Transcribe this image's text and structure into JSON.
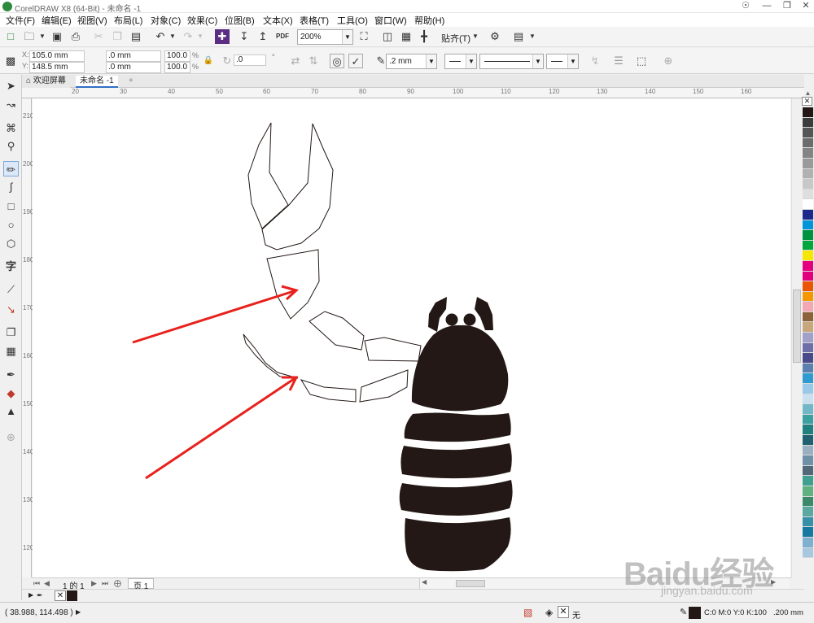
{
  "window": {
    "title": "CorelDRAW X8 (64-Bit) - 未命名 -1"
  },
  "menu": [
    "文件(F)",
    "编辑(E)",
    "视图(V)",
    "布局(L)",
    "对象(C)",
    "效果(C)",
    "位图(B)",
    "文本(X)",
    "表格(T)",
    "工具(O)",
    "窗口(W)",
    "帮助(H)"
  ],
  "toolbar": {
    "zoom": "200%",
    "snap_label": "贴齐(T)",
    "pdf_label": "PDF"
  },
  "property_bar": {
    "x": "105.0 mm",
    "y": "148.5 mm",
    "width": ".0 mm",
    "height": ".0 mm",
    "scale_x": "100.0",
    "scale_y": "100.0",
    "percent": "%",
    "rotation": ".0",
    "outline_width": ".2 mm"
  },
  "tabs": {
    "welcome": "欢迎屏幕",
    "document": "未命名 -1"
  },
  "ruler_h": [
    "20",
    "30",
    "40",
    "50",
    "60",
    "70",
    "80",
    "90",
    "100",
    "110",
    "120",
    "130",
    "140",
    "150",
    "160"
  ],
  "ruler_v": [
    "210",
    "200",
    "190",
    "180",
    "170",
    "160",
    "150",
    "140",
    "130",
    "120"
  ],
  "page_nav": {
    "counter": "1 的 1",
    "page_tab": "页 1"
  },
  "status": {
    "coords": "( 38.988, 114.498 )",
    "fill_none": "无",
    "outline_color": "C:0 M:0 Y:0 K:100",
    "outline_width": ".200 mm"
  },
  "watermark": {
    "brand": "Baidu经验",
    "url": "jingyan.baidu.com"
  },
  "colors": {
    "scorpion": "#231815",
    "arrow": "#e8211c",
    "palette": [
      "#231815",
      "#3c3c3c",
      "#555555",
      "#6c6c6c",
      "#848484",
      "#9a9a9a",
      "#b1b1b1",
      "#c8c8c8",
      "#dedede",
      "#ffffff",
      "#1b2a8a",
      "#0094d8",
      "#00923f",
      "#00a73c",
      "#f7e600",
      "#e5007f",
      "#e4007d",
      "#ea5504",
      "#f39800",
      "#f3a7b3",
      "#8c6239",
      "#c9a77c",
      "#a0a0c8",
      "#6e6ea8",
      "#4a4a8a",
      "#5a80b0",
      "#2e9ad0",
      "#9ac8e8",
      "#c8e0f0",
      "#70b8c8",
      "#3aa0a0",
      "#208080",
      "#206070",
      "#9ab0c0",
      "#7090a8",
      "#506878",
      "#40a090",
      "#60b080",
      "#3a8a6a",
      "#5aa8a0",
      "#3890a8",
      "#1878a0",
      "#80b0d0",
      "#a8c8e0"
    ]
  }
}
